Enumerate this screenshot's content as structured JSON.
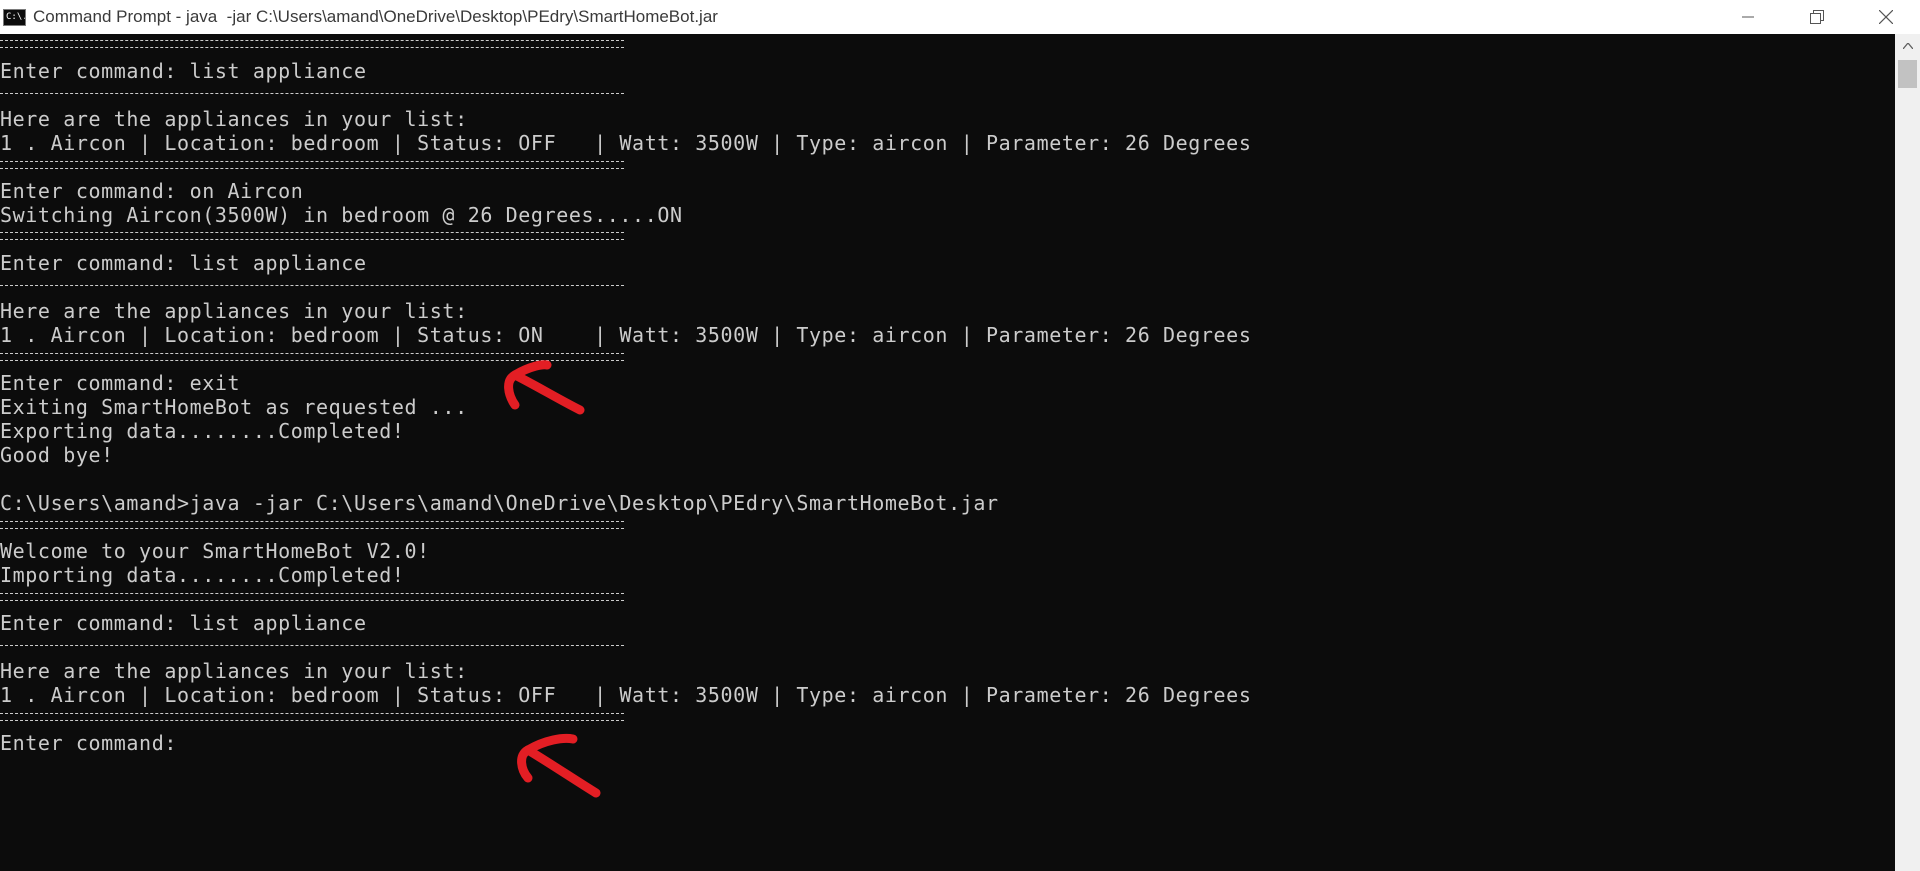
{
  "window": {
    "title": "Command Prompt - java  -jar C:\\Users\\amand\\OneDrive\\Desktop\\PEdry\\SmartHomeBot.jar",
    "icon_text": "C:\\."
  },
  "colors": {
    "console_bg": "#0c0c0c",
    "console_text": "#cccccc",
    "annotation_red": "#e31e24"
  },
  "console": {
    "lines": [
      "Enter command: list appliance",
      "Here are the appliances in your list:",
      "1 . Aircon | Location: bedroom | Status: OFF   | Watt: 3500W | Type: aircon | Parameter: 26 Degrees",
      "Enter command: on Aircon",
      "Switching Aircon(3500W) in bedroom @ 26 Degrees.....ON",
      "Enter command: list appliance",
      "Here are the appliances in your list:",
      "1 . Aircon | Location: bedroom | Status: ON    | Watt: 3500W | Type: aircon | Parameter: 26 Degrees",
      "Enter command: exit",
      "Exiting SmartHomeBot as requested ...",
      "Exporting data........Completed!",
      "Good bye!",
      "C:\\Users\\amand>java -jar C:\\Users\\amand\\OneDrive\\Desktop\\PEdry\\SmartHomeBot.jar",
      "Welcome to your SmartHomeBot V2.0!",
      "Importing data........Completed!",
      "Enter command: list appliance",
      "Here are the appliances in your list:",
      "1 . Aircon | Location: bedroom | Status: OFF   | Watt: 3500W | Type: aircon | Parameter: 26 Degrees",
      "Enter command: "
    ]
  }
}
